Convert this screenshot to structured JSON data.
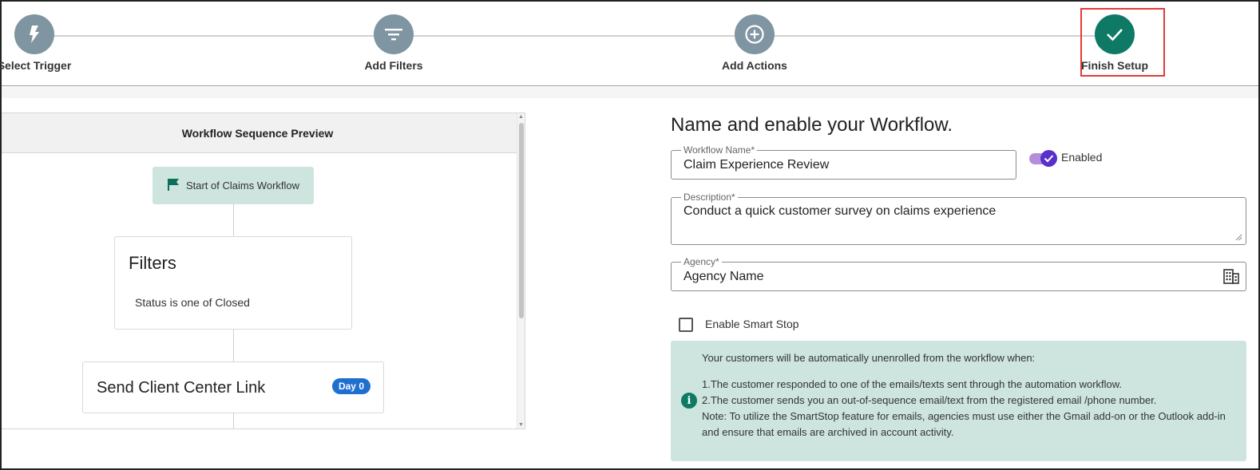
{
  "stepper": {
    "steps": [
      {
        "label": "Select Trigger",
        "icon": "bolt-icon",
        "state": "inactive"
      },
      {
        "label": "Add Filters",
        "icon": "filter-icon",
        "state": "inactive"
      },
      {
        "label": "Add Actions",
        "icon": "plus-circle-icon",
        "state": "inactive"
      },
      {
        "label": "Finish Setup",
        "icon": "check-icon",
        "state": "active"
      }
    ]
  },
  "preview": {
    "header": "Workflow Sequence Preview",
    "start_node": "Start of Claims Workflow",
    "filters_title": "Filters",
    "filters_text": "Status is one of Closed",
    "action_title": "Send Client Center Link",
    "action_badge": "Day 0"
  },
  "form": {
    "title": "Name and enable your Workflow.",
    "workflow_name": {
      "label": "Workflow Name*",
      "value": "Claim Experience Review"
    },
    "toggle_label": "Enabled",
    "description": {
      "label": "Description*",
      "value": "Conduct a quick customer survey on claims experience"
    },
    "agency": {
      "label": "Agency*",
      "value": "Agency Name"
    },
    "smart_stop_label": "Enable Smart Stop",
    "info": {
      "intro": "Your customers will be automatically unenrolled from the workflow when:",
      "line1": "1.The customer responded to one of the emails/texts sent through the automation workflow.",
      "line2": "2.The customer sends you an out-of-sequence email/text from the registered email /phone number.",
      "note": "Note: To utilize the SmartStop feature for emails, agencies must use either the Gmail add-on or the Outlook add-in and ensure that emails are archived in account activity."
    }
  },
  "colors": {
    "step_inactive": "#7f95a1",
    "step_active": "#0e7a66",
    "highlight": "#e23b3b",
    "node_bg": "#cde5de",
    "badge": "#1f6fd1",
    "toggle": "#5a2fc9"
  }
}
